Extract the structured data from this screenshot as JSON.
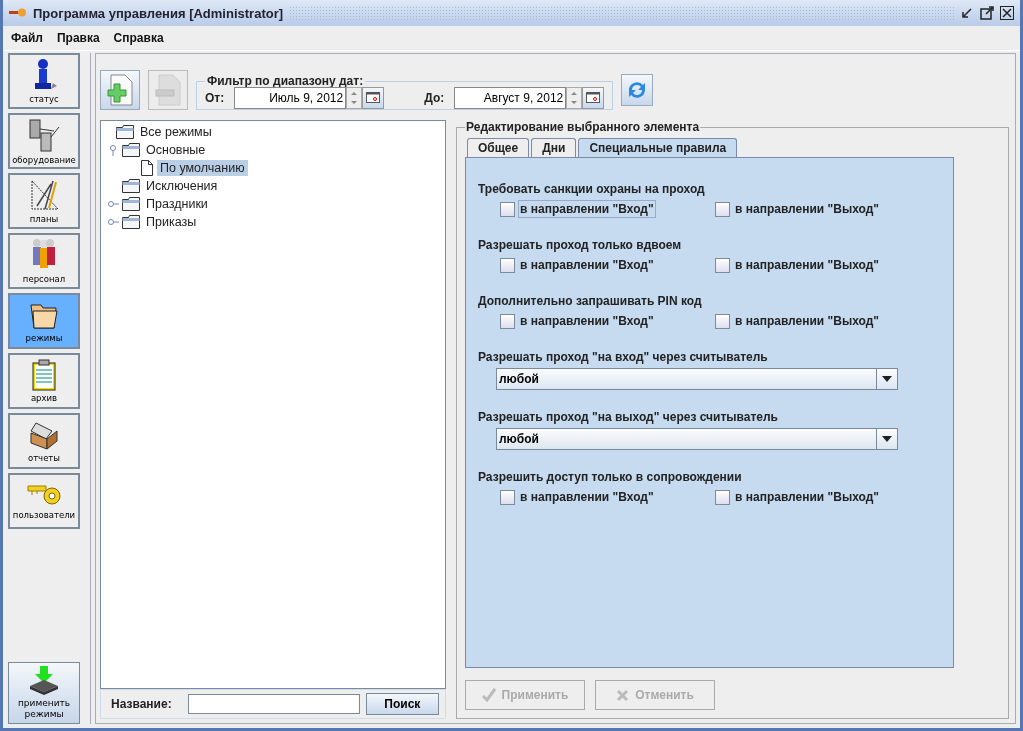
{
  "window": {
    "title": "Программа управления [Administrator]"
  },
  "menu": [
    "Файл",
    "Правка",
    "Справка"
  ],
  "sidebar": {
    "items": [
      {
        "label": "статус",
        "selected": false,
        "kind": "status"
      },
      {
        "label": "оборудование",
        "selected": false,
        "kind": "equipment"
      },
      {
        "label": "планы",
        "selected": false,
        "kind": "plans"
      },
      {
        "label": "персонал",
        "selected": false,
        "kind": "staff"
      },
      {
        "label": "режимы",
        "selected": true,
        "kind": "modes"
      },
      {
        "label": "архив",
        "selected": false,
        "kind": "archive"
      },
      {
        "label": "отчеты",
        "selected": false,
        "kind": "reports"
      },
      {
        "label": "пользователи",
        "selected": false,
        "kind": "users"
      }
    ],
    "apply_button": {
      "label": "применить режимы"
    }
  },
  "toolbar": {
    "add_button": {
      "disabled": false
    },
    "remove_button": {
      "disabled": true
    }
  },
  "date_filter": {
    "title": "Фильтр по диапазону дат:",
    "from_label": "От:",
    "from_value": "Июль 9, 2012",
    "to_label": "До:",
    "to_value": "Август 9, 2012"
  },
  "tree": {
    "label": "Все режимы",
    "kind": "folder",
    "selected": false,
    "children": [
      {
        "label": "Основные",
        "kind": "folder",
        "selected": false,
        "expanded": true,
        "children": [
          {
            "label": "По умолчанию",
            "kind": "document",
            "selected": true
          }
        ]
      },
      {
        "label": "Исключения",
        "kind": "folder",
        "selected": false
      },
      {
        "label": "Праздники",
        "kind": "folder",
        "selected": false,
        "expanded": false
      },
      {
        "label": "Приказы",
        "kind": "folder",
        "selected": false,
        "expanded": false
      }
    ]
  },
  "search": {
    "label": "Название:",
    "button": "Поиск"
  },
  "editor": {
    "title": "Редактирование выбранного элемента",
    "tabs": [
      {
        "label": "Общее",
        "selected": false
      },
      {
        "label": "Дни",
        "selected": false
      },
      {
        "label": "Специальные правила",
        "selected": true
      }
    ],
    "sections": [
      {
        "kind": "checkboxes",
        "title": "Требовать санкции охраны на проход",
        "options": [
          {
            "label": "в направлении \"Вход\"",
            "checked": false,
            "focused": true
          },
          {
            "label": "в направлении \"Выход\"",
            "checked": false,
            "focused": false
          }
        ]
      },
      {
        "kind": "checkboxes",
        "title": "Разрешать проход только вдвоем",
        "options": [
          {
            "label": "в направлении \"Вход\"",
            "checked": false,
            "focused": false
          },
          {
            "label": "в направлении \"Выход\"",
            "checked": false,
            "focused": false
          }
        ]
      },
      {
        "kind": "checkboxes",
        "title": "Дополнительно запрашивать PIN код",
        "options": [
          {
            "label": "в направлении \"Вход\"",
            "checked": false,
            "focused": false
          },
          {
            "label": "в направлении \"Выход\"",
            "checked": false,
            "focused": false
          }
        ]
      },
      {
        "kind": "dropdown",
        "title": "Разрешать проход \"на вход\" через считыватель",
        "value": "любой"
      },
      {
        "kind": "dropdown",
        "title": "Разрешать проход \"на выход\" через считыватель",
        "value": "любой"
      },
      {
        "kind": "checkboxes",
        "title": "Разрешить доступ только в сопровождении",
        "options": [
          {
            "label": "в направлении \"Вход\"",
            "checked": false,
            "focused": false
          },
          {
            "label": "в направлении \"Выход\"",
            "checked": false,
            "focused": false
          }
        ]
      }
    ],
    "buttons": [
      {
        "label": "Применить",
        "kind": "apply",
        "disabled": true
      },
      {
        "label": "Отменить",
        "kind": "cancel",
        "disabled": true
      }
    ]
  }
}
